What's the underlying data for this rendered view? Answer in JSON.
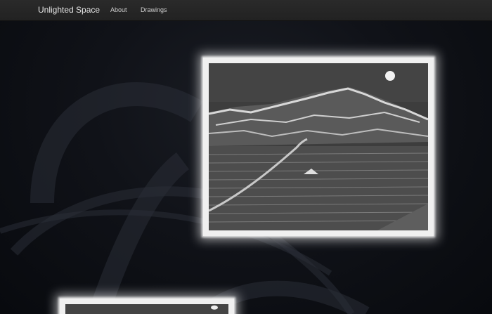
{
  "navbar": {
    "brand": "Unlighted Space",
    "links": [
      {
        "label": "About"
      },
      {
        "label": "Drawings"
      }
    ]
  },
  "gallery": {
    "items": [
      {
        "icon": "mountain-lake-drawing-image"
      },
      {
        "icon": "drawing-thumbnail-image"
      }
    ]
  },
  "colors": {
    "navbar_bg": "#252525",
    "page_bg": "#0b0d12",
    "frame_glow": "#ffffff"
  }
}
